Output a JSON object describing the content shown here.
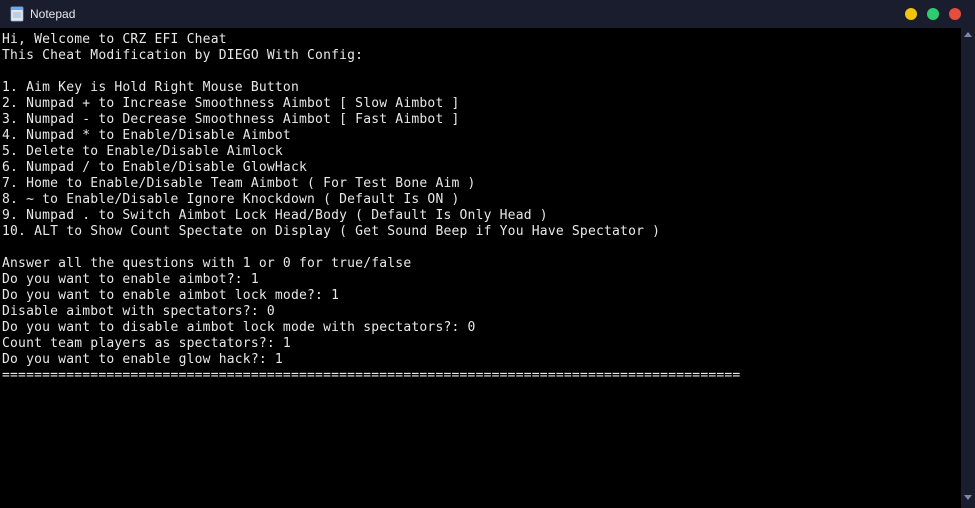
{
  "window": {
    "title": "Notepad"
  },
  "controls": {
    "minimize": "minimize",
    "maximize": "maximize",
    "close": "close"
  },
  "body": {
    "greeting": "Hi, Welcome to CRZ EFI Cheat",
    "subtitle": "This Cheat Modification by DIEGO With Config:",
    "instructions": [
      "1. Aim Key is Hold Right Mouse Button",
      "2. Numpad + to Increase Smoothness Aimbot [ Slow Aimbot ]",
      "3. Numpad - to Decrease Smoothness Aimbot [ Fast Aimbot ]",
      "4. Numpad * to Enable/Disable Aimbot",
      "5. Delete to Enable/Disable Aimlock",
      "6. Numpad / to Enable/Disable GlowHack",
      "7. Home to Enable/Disable Team Aimbot ( For Test Bone Aim )",
      "8. ~ to Enable/Disable Ignore Knockdown ( Default Is ON )",
      "9. Numpad . to Switch Aimbot Lock Head/Body ( Default Is Only Head )",
      "10. ALT to Show Count Spectate on Display ( Get Sound Beep if You Have Spectator )"
    ],
    "prompt_header": "Answer all the questions with 1 or 0 for true/false",
    "questions": [
      {
        "q": "Do you want to enable aimbot?:",
        "a": "1"
      },
      {
        "q": "Do you want to enable aimbot lock mode?:",
        "a": "1"
      },
      {
        "q": "Disable aimbot with spectators?:",
        "a": "0"
      },
      {
        "q": "Do you want to disable aimbot lock mode with spectators?:",
        "a": "0"
      },
      {
        "q": "Count team players as spectators?:",
        "a": "1"
      },
      {
        "q": "Do you want to enable glow hack?:",
        "a": "1"
      }
    ],
    "divider": "============================================================================================"
  }
}
